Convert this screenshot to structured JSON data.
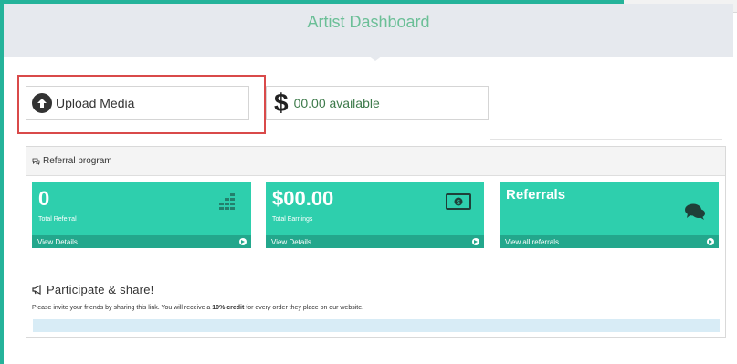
{
  "header": {
    "title": "Artist Dashboard"
  },
  "upload": {
    "label": "Upload Media",
    "icon": "upload-arrow-icon"
  },
  "balance": {
    "symbol": "$",
    "label": "00.00 available"
  },
  "referral": {
    "title": "Referral program",
    "cards": [
      {
        "value": "0",
        "caption": "Total Referral",
        "link": "View Details",
        "icon": "bar-chart-icon"
      },
      {
        "value": "$00.00",
        "caption": "Total Earnings",
        "link": "View Details",
        "icon": "money-icon"
      },
      {
        "value": "Referrals",
        "caption": "",
        "link": "View all referrals",
        "icon": "chat-icon"
      }
    ]
  },
  "share": {
    "title": "Participate & share!",
    "text_before": "Please invite your friends by sharing this link. You will receive a ",
    "text_bold": "10% credit",
    "text_after": " for every order they place on our website."
  },
  "link_bar": {
    "text": ""
  },
  "colors": {
    "accent": "#2ecfad",
    "accent_dark": "#23a78c",
    "header_title": "#6bbf97",
    "highlight": "#d94a4a"
  }
}
